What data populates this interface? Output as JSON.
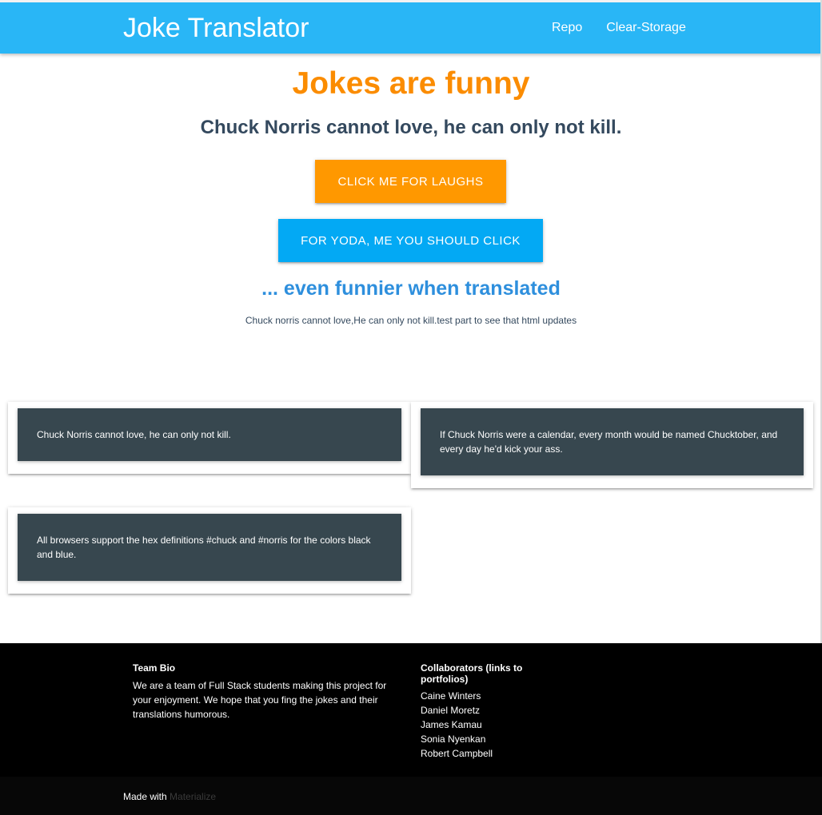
{
  "navbar": {
    "brand": "Joke Translator",
    "links": [
      "Repo",
      "Clear-Storage"
    ]
  },
  "hero": {
    "title": "Jokes are funny",
    "joke": "Chuck Norris cannot love, he can only not kill.",
    "laugh_button": "CLICK ME FOR LAUGHS",
    "yoda_button": "FOR YODA, ME YOU SHOULD CLICK",
    "funnier": "... even funnier when translated",
    "translated": "Chuck norris cannot love,He can only not kill.test part to see that html updates"
  },
  "cards": [
    "Chuck Norris cannot love, he can only not kill.",
    "If Chuck Norris were a calendar, every month would be named Chucktober, and every day he'd kick your ass.",
    "All browsers support the hex definitions #chuck and #norris for the colors black and blue."
  ],
  "footer": {
    "bio_title": "Team Bio",
    "bio_text": "We are a team of Full Stack students making this project for your enjoyment. We hope that you fing the jokes and their translations humorous.",
    "collab_title": "Collaborators (links to portfolios)",
    "collaborators": [
      "Caine Winters",
      "Daniel Moretz",
      "James Kamau",
      "Sonia Nyenkan",
      "Robert Campbell"
    ],
    "made_with": "Made with",
    "made_with_link": "Materialize"
  },
  "colors": {
    "navbar": "#29b6f6",
    "orange": "#ff9800",
    "blue_button": "#03a9f4",
    "card": "#37474f"
  }
}
